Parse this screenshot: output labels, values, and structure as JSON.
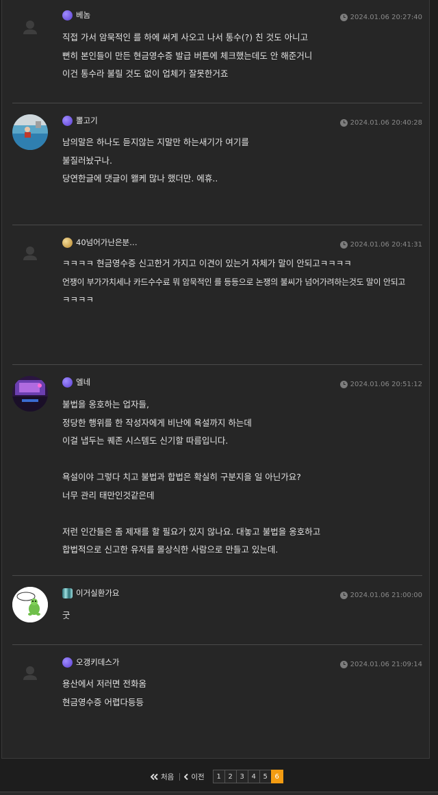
{
  "comments": [
    {
      "nick": "베놈",
      "level_color": "#6a4fe0",
      "time": "2024.01.06 20:27:40",
      "avatar": "default-avatar",
      "lines": [
        "직접 가서 암묵적인 를 하에 써게 사오고 나서 통수(?) 친 것도 아니고",
        "뻔히 본인들이 만든 현금영수증 발급 버튼에 체크했는데도 안 해준거니",
        "이건 통수라 불릴 것도 없이 업체가 잘못한거죠"
      ]
    },
    {
      "nick": "뽈고기",
      "level_color": "#6a4fe0",
      "time": "2024.01.06 20:40:28",
      "avatar": "photo-pool",
      "lines": [
        "남의말은 하나도 듣지않는 지말만 하는새기가 여기를",
        "불질러놨구나.",
        "당연한글에 댓글이 왤케 많나 했더만. 에휴.."
      ]
    },
    {
      "nick": "40넘어가난은분…",
      "level_color": "#c9a24a",
      "time": "2024.01.06 20:41:31",
      "avatar": "default-avatar",
      "lines": [
        "ㅋㅋㅋㅋ 현금영수증 신고한거 가지고 이견이 있는거 자체가 말이 안되고ㅋㅋㅋㅋ",
        "언쟁이 부가가치세나 카드수수료 뭐 암묵적인 를 등등으로 논쟁의 불씨가 넘어가려하는것도 말이 안되고",
        "ㅋㅋㅋㅋ"
      ]
    },
    {
      "nick": "엘네",
      "level_color": "#6a4fe0",
      "time": "2024.01.06 20:51:12",
      "avatar": "photo-room",
      "lines": [
        "불법을 옹호하는 업자들,",
        "정당한 행위를 한 작성자에게 비난에 욕설까지 하는데",
        "이걸 냅두는 퀘존 시스템도 신기할 따름입니다.",
        "",
        "욕설이야 그렇다 치고 불법과 합법은 확실히 구분지을 일 아닌가요?",
        "너무 관리 태만인것같은데",
        "",
        "저런 인간들은 좀 제재를 할 필요가 있지 않나요. 대놓고 불법을 옹호하고",
        "합법적으로 신고한 유저를 몰상식한 사람으로 만들고 있는데."
      ]
    },
    {
      "nick": "이거실환가요",
      "level_color": "#3aa0a8",
      "time": "2024.01.06 21:00:00",
      "avatar": "drawing-turtle",
      "lines": [
        "굿"
      ]
    },
    {
      "nick": "오갱키데스가",
      "level_color": "#6a4fe0",
      "time": "2024.01.06 21:09:14",
      "avatar": "default-avatar",
      "lines": [
        "용산에서 저러면 전화옴",
        "현금영수증 어렵다등등"
      ]
    }
  ],
  "pager": {
    "first_label": "처음",
    "prev_label": "이전",
    "pages": [
      "1",
      "2",
      "3",
      "4",
      "5",
      "6"
    ],
    "current": "6"
  },
  "colors": {
    "accent": "#f39c12",
    "background": "#262626"
  }
}
